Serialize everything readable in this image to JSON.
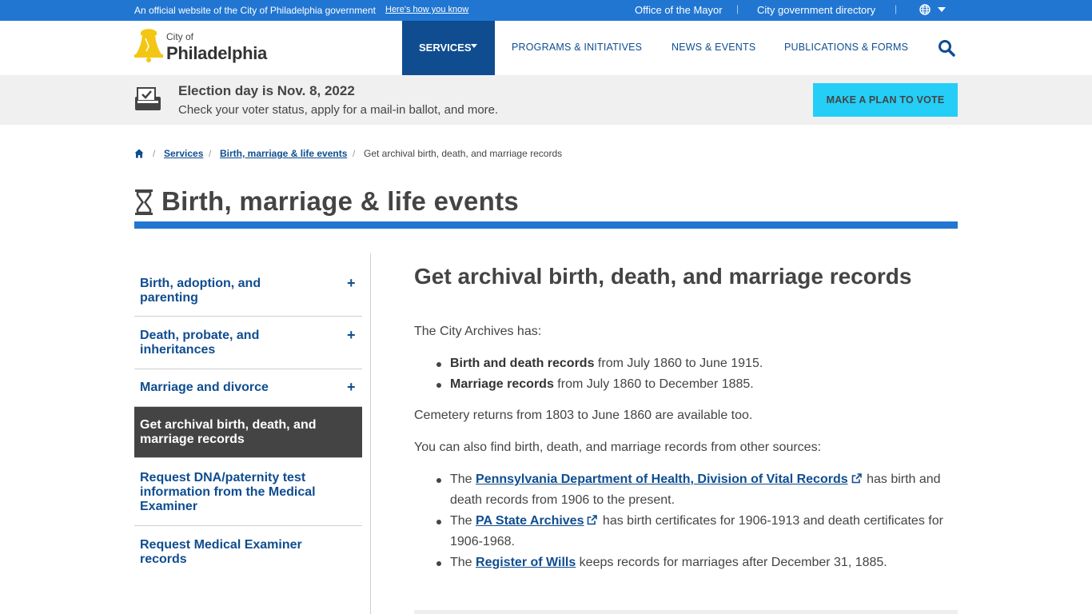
{
  "topbar": {
    "official_text": "An official website of the City of Philadelphia government",
    "how_you_know": "Here's how you know",
    "mayor_link": "Office of the Mayor",
    "directory_link": "City government directory",
    "separator": "|"
  },
  "header": {
    "logo_city_of": "City of",
    "logo_name": "Philadelphia",
    "nav": {
      "services": "SERVICES",
      "programs": "PROGRAMS & INITIATIVES",
      "news": "NEWS & EVENTS",
      "publications": "PUBLICATIONS & FORMS"
    }
  },
  "banner": {
    "title": "Election day is Nov. 8, 2022",
    "subtitle": "Check your voter status, apply for a mail-in ballot, and more.",
    "button": "MAKE A PLAN TO VOTE"
  },
  "breadcrumb": {
    "separator": "/",
    "items": [
      "Services",
      "Birth, marriage & life events"
    ],
    "current": "Get archival birth, death, and marriage records"
  },
  "page_title": "Birth, marriage & life events",
  "sidebar": {
    "items": [
      {
        "label": "Birth, adoption, and parenting",
        "expand": "+"
      },
      {
        "label": "Death, probate, and inheritances",
        "expand": "+"
      },
      {
        "label": "Marriage and divorce",
        "expand": "+"
      },
      {
        "label": "Get archival birth, death, and marriage records"
      },
      {
        "label": "Request DNA/paternity test information from the Medical Examiner"
      },
      {
        "label": "Request Medical Examiner records"
      }
    ]
  },
  "main": {
    "heading": "Get archival birth, death, and marriage records",
    "intro": "The City Archives has:",
    "archives_list": [
      {
        "bold": "Birth and death records",
        "rest": " from July 1860 to June 1915."
      },
      {
        "bold": "Marriage records",
        "rest": " from July 1860 to December 1885."
      }
    ],
    "cemetery": "Cemetery returns from 1803 to June 1860 are available too.",
    "other_sources": "You can also find birth, death, and marriage records from other sources:",
    "sources_list": [
      {
        "pre": "The ",
        "link": "Pennsylvania Department of Health, Division of Vital Records",
        "post": " has birth and death records from 1906 to the present."
      },
      {
        "pre": "The ",
        "link": "PA State Archives",
        "post": " has birth certificates for 1906-1913 and death certificates for 1906-1968."
      },
      {
        "pre": "The ",
        "link": "Register of Wills",
        "post": " keeps records for marriages after December 31, 1885."
      }
    ]
  },
  "colors": {
    "brand_blue": "#2176d2",
    "dark_blue": "#0f4d90",
    "cta_cyan": "#25cef7",
    "active_gray": "#444444",
    "banner_gray": "#f0f0f0"
  },
  "icons": [
    "globe-icon",
    "chevron-down-icon",
    "liberty-bell-logo",
    "search-icon",
    "ballot-box-icon",
    "home-icon",
    "hourglass-icon",
    "external-link-icon"
  ]
}
